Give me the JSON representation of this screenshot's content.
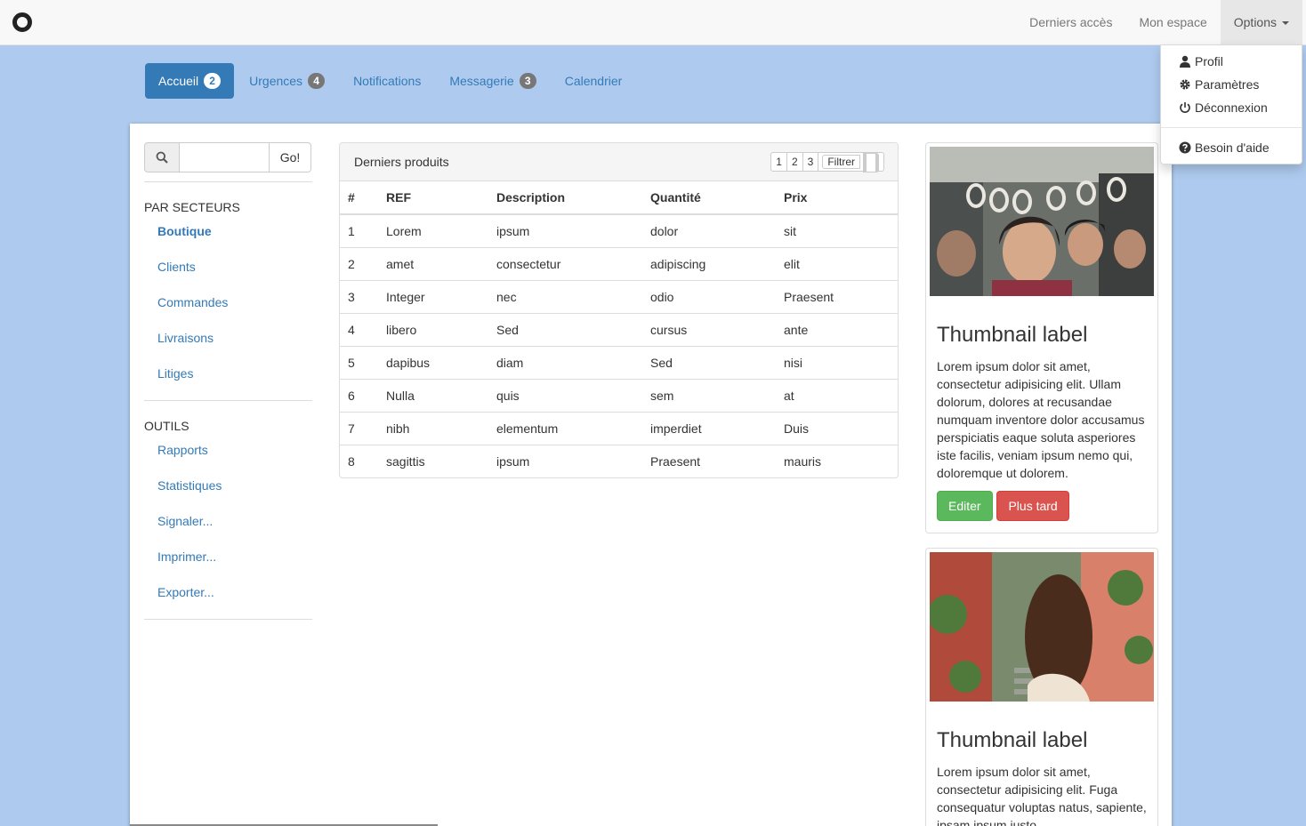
{
  "navbar": {
    "items": [
      {
        "label": "Derniers accès"
      },
      {
        "label": "Mon espace"
      },
      {
        "label": "Options"
      }
    ]
  },
  "options_menu": {
    "items": [
      {
        "label": "Profil",
        "icon": "user-icon"
      },
      {
        "label": "Paramètres",
        "icon": "gear-icon"
      },
      {
        "label": "Déconnexion",
        "icon": "power-icon"
      },
      {
        "label": "Besoin d'aide",
        "icon": "question-circle-icon"
      }
    ]
  },
  "tabs": [
    {
      "label": "Accueil",
      "badge": "2"
    },
    {
      "label": "Urgences",
      "badge": "4"
    },
    {
      "label": "Notifications",
      "badge": ""
    },
    {
      "label": "Messagerie",
      "badge": "3"
    },
    {
      "label": "Calendrier",
      "badge": ""
    }
  ],
  "search": {
    "placeholder": "",
    "value": "",
    "button": "Go!"
  },
  "sidebar": {
    "sectors_title": "PAR SECTEURS",
    "sectors": [
      "Boutique",
      "Clients",
      "Commandes",
      "Livraisons",
      "Litiges"
    ],
    "tools_title": "OUTILS",
    "tools": [
      "Rapports",
      "Statistiques",
      "Signaler...",
      "Imprimer...",
      "Exporter..."
    ]
  },
  "products": {
    "title": "Derniers produits",
    "pages": [
      "1",
      "2",
      "3"
    ],
    "filter_label": "Filtrer",
    "columns": [
      "#",
      "REF",
      "Description",
      "Quantité",
      "Prix"
    ],
    "rows": [
      [
        "1",
        "Lorem",
        "ipsum",
        "dolor",
        "sit"
      ],
      [
        "2",
        "amet",
        "consectetur",
        "adipiscing",
        "elit"
      ],
      [
        "3",
        "Integer",
        "nec",
        "odio",
        "Praesent"
      ],
      [
        "4",
        "libero",
        "Sed",
        "cursus",
        "ante"
      ],
      [
        "5",
        "dapibus",
        "diam",
        "Sed",
        "nisi"
      ],
      [
        "6",
        "Nulla",
        "quis",
        "sem",
        "at"
      ],
      [
        "7",
        "nibh",
        "elementum",
        "imperdiet",
        "Duis"
      ],
      [
        "8",
        "sagittis",
        "ipsum",
        "Praesent",
        "mauris"
      ]
    ]
  },
  "thumbnails": [
    {
      "label": "Thumbnail label",
      "text": "Lorem ipsum dolor sit amet, consectetur adipisicing elit. Ullam dolorum, dolores at recusandae numquam inventore dolor accusamus perspiciatis eaque soluta asperiores iste facilis, veniam ipsum nemo qui, doloremque ut dolorem.",
      "edit_button": "Editer",
      "later_button": "Plus tard"
    },
    {
      "label": "Thumbnail label",
      "text": "Lorem ipsum dolor sit amet, consectetur adipisicing elit. Fuga consequatur voluptas natus, sapiente, ipsam ipsum iusto"
    }
  ],
  "colors": {
    "background": "#aecbef",
    "primary": "#337ab7",
    "success": "#5cb85c",
    "danger": "#d9534f"
  }
}
